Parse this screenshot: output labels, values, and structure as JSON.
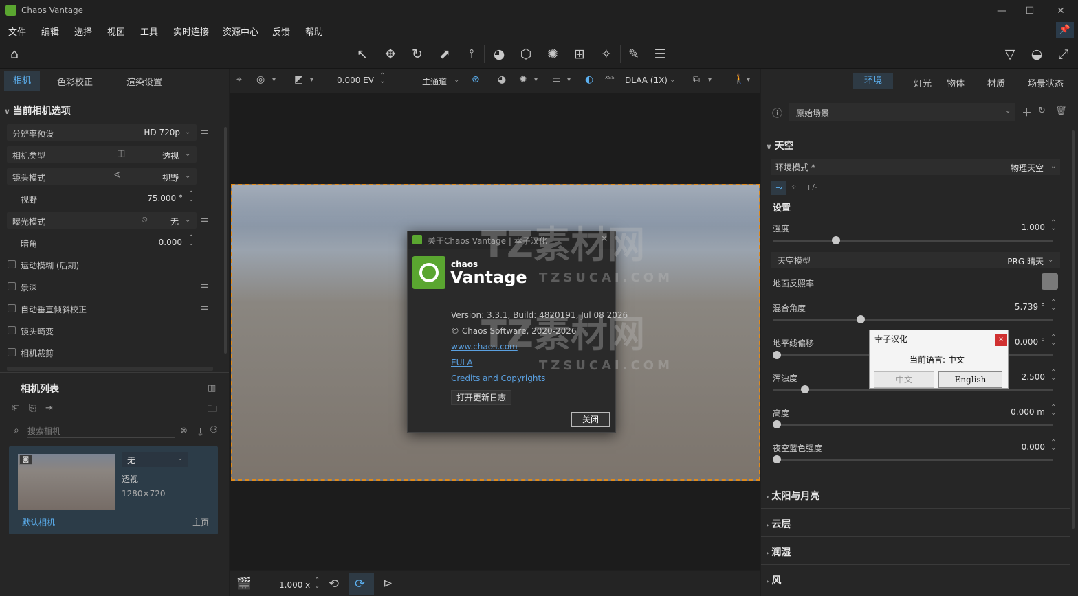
{
  "window": {
    "title": "Chaos Vantage",
    "minimize": "—",
    "maximize": "☐",
    "close": "✕"
  },
  "menu": [
    "文件",
    "编辑",
    "选择",
    "视图",
    "工具",
    "实时连接",
    "资源中心",
    "反馈",
    "帮助"
  ],
  "left_tabs": [
    "相机",
    "色彩校正",
    "渲染设置"
  ],
  "camera_options": {
    "title": "当前相机选项",
    "resolution_label": "分辨率预设",
    "resolution_value": "HD 720p",
    "camera_type_label": "相机类型",
    "camera_type_value": "透视",
    "lens_mode_label": "镜头模式",
    "lens_mode_value": "视野",
    "fov_label": "视野",
    "fov_value": "75.000 °",
    "exposure_label": "曝光模式",
    "exposure_value": "无",
    "vignette_label": "暗角",
    "vignette_value": "0.000",
    "motion_blur": "运动模糊 (后期)",
    "dof": "景深",
    "auto_vertical": "自动垂直倾斜校正",
    "lens_distortion": "镜头畸变",
    "camera_crop": "相机裁剪"
  },
  "camera_list": {
    "title": "相机列表",
    "search_placeholder": "搜索相机",
    "card": {
      "dropdown": "无",
      "type": "透视",
      "resolution": "1280×720",
      "name": "默认相机",
      "tag": "主页"
    }
  },
  "viewbar": {
    "ev": "0.000 EV",
    "channel": "主通道",
    "aa": "DLAA (1X)",
    "xss": "XSS"
  },
  "bottombar": {
    "speed": "1.000 x"
  },
  "right_tabs": [
    "环境",
    "灯光",
    "物体",
    "材质",
    "场景状态"
  ],
  "env": {
    "scene": "原始场景",
    "sky_title": "天空",
    "env_mode_label": "环境模式 *",
    "env_mode_value": "物理天空",
    "settings_title": "设置",
    "intensity_label": "强度",
    "intensity_value": "1.000",
    "intensity_pos": 0.21,
    "sky_model_label": "天空模型",
    "sky_model_value": "PRG 晴天",
    "ground_albedo_label": "地面反照率",
    "blend_angle_label": "混合角度",
    "blend_angle_value": "5.739 °",
    "blend_angle_pos": 0.3,
    "horizon_offset_label": "地平线偏移",
    "horizon_offset_value": "0.000 °",
    "horizon_offset_pos": 0.0,
    "turbidity_label": "浑浊度",
    "turbidity_value": "2.500",
    "turbidity_pos": 0.1,
    "altitude_label": "高度",
    "altitude_value": "0.000 m",
    "altitude_pos": 0.0,
    "night_blue_label": "夜空蓝色强度",
    "night_blue_value": "0.000",
    "night_blue_pos": 0.0,
    "collapsed": [
      "太阳与月亮",
      "云层",
      "润湿",
      "风"
    ]
  },
  "about": {
    "title": "关于Chaos Vantage | 幸子汉化",
    "brand_small": "chaos",
    "brand_big": "Vantage",
    "version": "Version: 3.3.1, Build: 4820191, Jul 08 2026",
    "copyright": "© Chaos Software, 2020-2026",
    "website": "www.chaos.com",
    "eula": "EULA",
    "credits": "Credits and Copyrights",
    "changelog_button": "打开更新日志",
    "close_button": "关闭"
  },
  "lang_popup": {
    "title": "幸子汉化",
    "current": "当前语言: 中文",
    "btn_cn": "中文",
    "btn_en": "English",
    "close": "✕"
  },
  "watermark": {
    "cn": "TZ素材网",
    "en": "TZSUCAI.COM"
  }
}
